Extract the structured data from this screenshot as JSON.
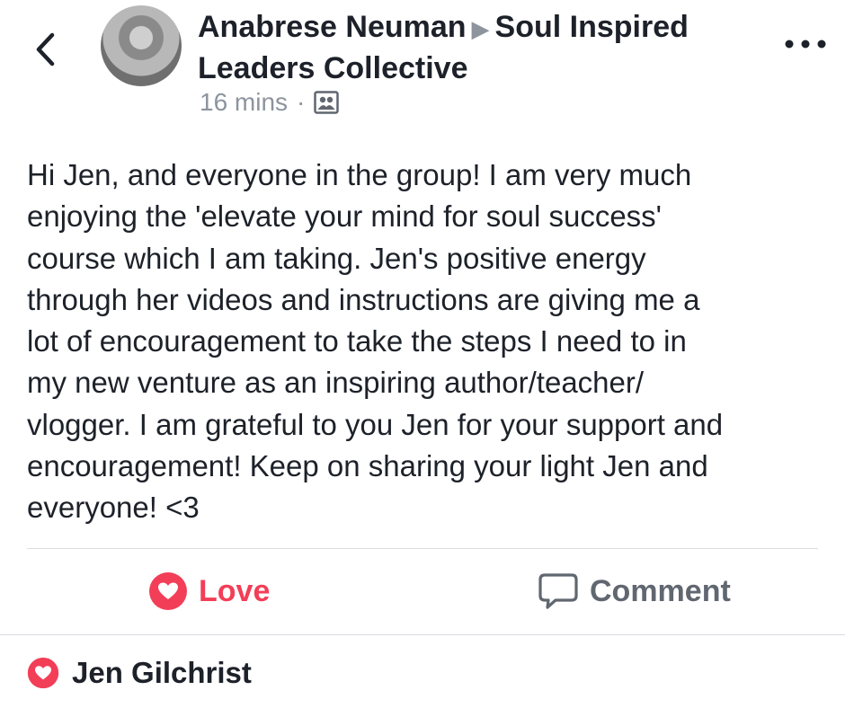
{
  "header": {
    "author": "Anabrese Neuman",
    "group_line1": "Soul Inspired",
    "group_line2": "Leaders Collective",
    "timestamp": "16 mins",
    "separator": "·",
    "audience_icon": "group-audience-icon",
    "back_icon": "chevron-left-icon",
    "more_icon": "more-horizontal-icon"
  },
  "post": {
    "text": "Hi Jen, and everyone in the group!  I am very much\nenjoying the 'elevate your mind for soul success'\ncourse which I am taking.  Jen's positive energy\nthrough her videos and instructions are giving me a\nlot of encouragement to take the steps I need to in\nmy new venture as an inspiring author/teacher/\nvlogger.  I am grateful to you Jen for your support and\nencouragement!  Keep on sharing your light Jen and\neveryone! <3"
  },
  "actions": {
    "love_label": "Love",
    "comment_label": "Comment"
  },
  "reactions": {
    "reactor_name": "Jen Gilchrist"
  },
  "colors": {
    "love": "#f33e58",
    "muted": "#8d949e",
    "action_text": "#606770",
    "divider": "#dadde1"
  }
}
